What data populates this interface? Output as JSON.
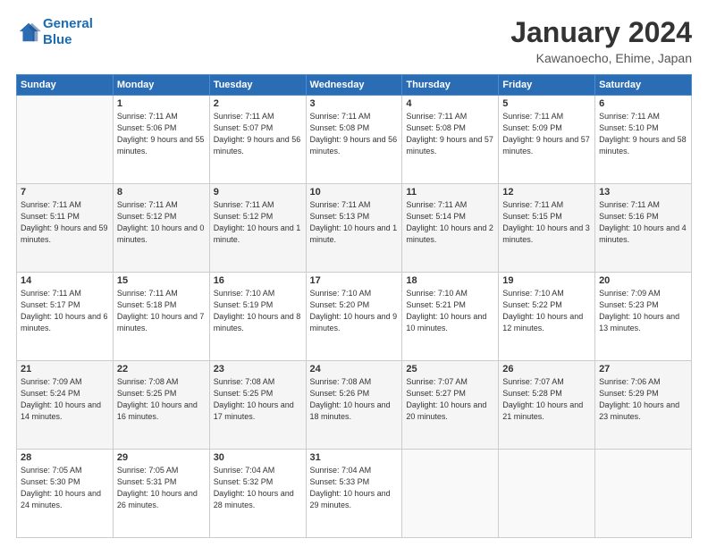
{
  "header": {
    "logo_line1": "General",
    "logo_line2": "Blue",
    "title": "January 2024",
    "subtitle": "Kawanoecho, Ehime, Japan"
  },
  "days_of_week": [
    "Sunday",
    "Monday",
    "Tuesday",
    "Wednesday",
    "Thursday",
    "Friday",
    "Saturday"
  ],
  "weeks": [
    [
      {
        "num": "",
        "sunrise": "",
        "sunset": "",
        "daylight": "",
        "empty": true
      },
      {
        "num": "1",
        "sunrise": "Sunrise: 7:11 AM",
        "sunset": "Sunset: 5:06 PM",
        "daylight": "Daylight: 9 hours and 55 minutes."
      },
      {
        "num": "2",
        "sunrise": "Sunrise: 7:11 AM",
        "sunset": "Sunset: 5:07 PM",
        "daylight": "Daylight: 9 hours and 56 minutes."
      },
      {
        "num": "3",
        "sunrise": "Sunrise: 7:11 AM",
        "sunset": "Sunset: 5:08 PM",
        "daylight": "Daylight: 9 hours and 56 minutes."
      },
      {
        "num": "4",
        "sunrise": "Sunrise: 7:11 AM",
        "sunset": "Sunset: 5:08 PM",
        "daylight": "Daylight: 9 hours and 57 minutes."
      },
      {
        "num": "5",
        "sunrise": "Sunrise: 7:11 AM",
        "sunset": "Sunset: 5:09 PM",
        "daylight": "Daylight: 9 hours and 57 minutes."
      },
      {
        "num": "6",
        "sunrise": "Sunrise: 7:11 AM",
        "sunset": "Sunset: 5:10 PM",
        "daylight": "Daylight: 9 hours and 58 minutes."
      }
    ],
    [
      {
        "num": "7",
        "sunrise": "Sunrise: 7:11 AM",
        "sunset": "Sunset: 5:11 PM",
        "daylight": "Daylight: 9 hours and 59 minutes."
      },
      {
        "num": "8",
        "sunrise": "Sunrise: 7:11 AM",
        "sunset": "Sunset: 5:12 PM",
        "daylight": "Daylight: 10 hours and 0 minutes."
      },
      {
        "num": "9",
        "sunrise": "Sunrise: 7:11 AM",
        "sunset": "Sunset: 5:12 PM",
        "daylight": "Daylight: 10 hours and 1 minute."
      },
      {
        "num": "10",
        "sunrise": "Sunrise: 7:11 AM",
        "sunset": "Sunset: 5:13 PM",
        "daylight": "Daylight: 10 hours and 1 minute."
      },
      {
        "num": "11",
        "sunrise": "Sunrise: 7:11 AM",
        "sunset": "Sunset: 5:14 PM",
        "daylight": "Daylight: 10 hours and 2 minutes."
      },
      {
        "num": "12",
        "sunrise": "Sunrise: 7:11 AM",
        "sunset": "Sunset: 5:15 PM",
        "daylight": "Daylight: 10 hours and 3 minutes."
      },
      {
        "num": "13",
        "sunrise": "Sunrise: 7:11 AM",
        "sunset": "Sunset: 5:16 PM",
        "daylight": "Daylight: 10 hours and 4 minutes."
      }
    ],
    [
      {
        "num": "14",
        "sunrise": "Sunrise: 7:11 AM",
        "sunset": "Sunset: 5:17 PM",
        "daylight": "Daylight: 10 hours and 6 minutes."
      },
      {
        "num": "15",
        "sunrise": "Sunrise: 7:11 AM",
        "sunset": "Sunset: 5:18 PM",
        "daylight": "Daylight: 10 hours and 7 minutes."
      },
      {
        "num": "16",
        "sunrise": "Sunrise: 7:10 AM",
        "sunset": "Sunset: 5:19 PM",
        "daylight": "Daylight: 10 hours and 8 minutes."
      },
      {
        "num": "17",
        "sunrise": "Sunrise: 7:10 AM",
        "sunset": "Sunset: 5:20 PM",
        "daylight": "Daylight: 10 hours and 9 minutes."
      },
      {
        "num": "18",
        "sunrise": "Sunrise: 7:10 AM",
        "sunset": "Sunset: 5:21 PM",
        "daylight": "Daylight: 10 hours and 10 minutes."
      },
      {
        "num": "19",
        "sunrise": "Sunrise: 7:10 AM",
        "sunset": "Sunset: 5:22 PM",
        "daylight": "Daylight: 10 hours and 12 minutes."
      },
      {
        "num": "20",
        "sunrise": "Sunrise: 7:09 AM",
        "sunset": "Sunset: 5:23 PM",
        "daylight": "Daylight: 10 hours and 13 minutes."
      }
    ],
    [
      {
        "num": "21",
        "sunrise": "Sunrise: 7:09 AM",
        "sunset": "Sunset: 5:24 PM",
        "daylight": "Daylight: 10 hours and 14 minutes."
      },
      {
        "num": "22",
        "sunrise": "Sunrise: 7:08 AM",
        "sunset": "Sunset: 5:25 PM",
        "daylight": "Daylight: 10 hours and 16 minutes."
      },
      {
        "num": "23",
        "sunrise": "Sunrise: 7:08 AM",
        "sunset": "Sunset: 5:25 PM",
        "daylight": "Daylight: 10 hours and 17 minutes."
      },
      {
        "num": "24",
        "sunrise": "Sunrise: 7:08 AM",
        "sunset": "Sunset: 5:26 PM",
        "daylight": "Daylight: 10 hours and 18 minutes."
      },
      {
        "num": "25",
        "sunrise": "Sunrise: 7:07 AM",
        "sunset": "Sunset: 5:27 PM",
        "daylight": "Daylight: 10 hours and 20 minutes."
      },
      {
        "num": "26",
        "sunrise": "Sunrise: 7:07 AM",
        "sunset": "Sunset: 5:28 PM",
        "daylight": "Daylight: 10 hours and 21 minutes."
      },
      {
        "num": "27",
        "sunrise": "Sunrise: 7:06 AM",
        "sunset": "Sunset: 5:29 PM",
        "daylight": "Daylight: 10 hours and 23 minutes."
      }
    ],
    [
      {
        "num": "28",
        "sunrise": "Sunrise: 7:05 AM",
        "sunset": "Sunset: 5:30 PM",
        "daylight": "Daylight: 10 hours and 24 minutes."
      },
      {
        "num": "29",
        "sunrise": "Sunrise: 7:05 AM",
        "sunset": "Sunset: 5:31 PM",
        "daylight": "Daylight: 10 hours and 26 minutes."
      },
      {
        "num": "30",
        "sunrise": "Sunrise: 7:04 AM",
        "sunset": "Sunset: 5:32 PM",
        "daylight": "Daylight: 10 hours and 28 minutes."
      },
      {
        "num": "31",
        "sunrise": "Sunrise: 7:04 AM",
        "sunset": "Sunset: 5:33 PM",
        "daylight": "Daylight: 10 hours and 29 minutes."
      },
      {
        "num": "",
        "sunrise": "",
        "sunset": "",
        "daylight": "",
        "empty": true
      },
      {
        "num": "",
        "sunrise": "",
        "sunset": "",
        "daylight": "",
        "empty": true
      },
      {
        "num": "",
        "sunrise": "",
        "sunset": "",
        "daylight": "",
        "empty": true
      }
    ]
  ]
}
